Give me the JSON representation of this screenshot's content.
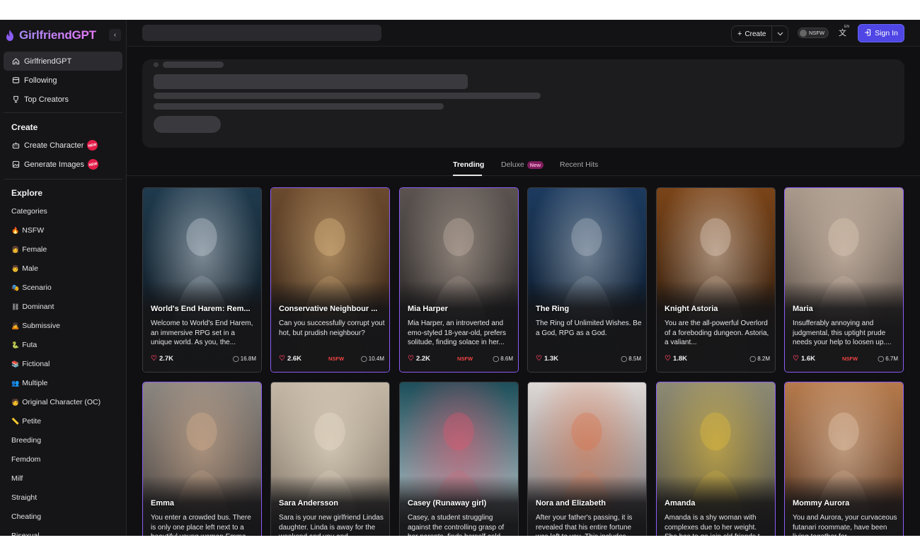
{
  "brand": {
    "name": "GirlfriendGPT",
    "accent": "#d946ef"
  },
  "sidebar": {
    "main_items": [
      {
        "label": "GirlfriendGPT",
        "icon": "home-icon"
      },
      {
        "label": "Following",
        "icon": "following-icon"
      },
      {
        "label": "Top Creators",
        "icon": "trophy-icon"
      }
    ],
    "create_title": "Create",
    "create_items": [
      {
        "label": "Create Character",
        "icon": "bot-icon",
        "badge": "NEW"
      },
      {
        "label": "Generate Images",
        "icon": "image-icon",
        "badge": "NEW"
      }
    ],
    "explore_title": "Explore",
    "categories": [
      {
        "label": "Categories",
        "emoji": ""
      },
      {
        "label": "NSFW",
        "emoji": "🔥"
      },
      {
        "label": "Female",
        "emoji": "👩"
      },
      {
        "label": "Male",
        "emoji": "👨"
      },
      {
        "label": "Scenario",
        "emoji": "🎭"
      },
      {
        "label": "Dominant",
        "emoji": "⛓"
      },
      {
        "label": "Submissive",
        "emoji": "🙇"
      },
      {
        "label": "Futa",
        "emoji": "🐍"
      },
      {
        "label": "Fictional",
        "emoji": "📚"
      },
      {
        "label": "Multiple",
        "emoji": "👥"
      },
      {
        "label": "Original Character (OC)",
        "emoji": "🧑"
      },
      {
        "label": "Petite",
        "emoji": "📏"
      },
      {
        "label": "Breeding",
        "emoji": ""
      },
      {
        "label": "Femdom",
        "emoji": ""
      },
      {
        "label": "Milf",
        "emoji": ""
      },
      {
        "label": "Straight",
        "emoji": ""
      },
      {
        "label": "Cheating",
        "emoji": ""
      },
      {
        "label": "Bisexual",
        "emoji": ""
      }
    ]
  },
  "topbar": {
    "create_label": "Create",
    "nsfw_label": "NSFW",
    "lang_code": "EN",
    "signin_label": "Sign In"
  },
  "tabs": [
    {
      "label": "Trending",
      "active": true
    },
    {
      "label": "Deluxe",
      "badge": "New"
    },
    {
      "label": "Recent Hits"
    }
  ],
  "cards": [
    {
      "name": "World's End Harem: Rem...",
      "desc": "Welcome to World's End Harem, an immersive RPG set in a unique world. As you, the...",
      "likes": "2.7K",
      "nsfw": "",
      "chats": "16.8M",
      "deluxe": false,
      "colors": [
        "#1f3a4d",
        "#0b1218",
        "#cfd8e0"
      ]
    },
    {
      "name": "Conservative Neighbour ...",
      "desc": "Can you successfully corrupt yout hot, but prudish neighbour?",
      "likes": "2.6K",
      "nsfw": "NSFW",
      "chats": "10.4M",
      "deluxe": true,
      "colors": [
        "#6b4a2e",
        "#2a1c12",
        "#e9c28a"
      ]
    },
    {
      "name": "Mia Harper",
      "desc": "Mia Harper, an introverted and emo-styled 18-year-old, prefers solitude, finding solace in her...",
      "likes": "2.2K",
      "nsfw": "NSFW",
      "chats": "8.6M",
      "deluxe": true,
      "colors": [
        "#5a5350",
        "#1c1a1a",
        "#c9b8aa"
      ]
    },
    {
      "name": "The Ring",
      "desc": "The Ring of Unlimited Wishes. Be a God, RPG as a God.",
      "likes": "1.3K",
      "nsfw": "",
      "chats": "8.5M",
      "deluxe": false,
      "colors": [
        "#1d3b5f",
        "#05101c",
        "#b9c4cf"
      ]
    },
    {
      "name": "Knight Astoria",
      "desc": "You are the all-powerful Overlord of a foreboding dungeon. Astoria, a valiant...",
      "likes": "1.8K",
      "nsfw": "",
      "chats": "8.2M",
      "deluxe": false,
      "colors": [
        "#7a4418",
        "#1b120c",
        "#e9d8c9"
      ]
    },
    {
      "name": "Maria",
      "desc": "Insufferably annoying and judgmental, this uptight prude needs your help to loosen up....",
      "likes": "1.6K",
      "nsfw": "NSFW",
      "chats": "6.7M",
      "deluxe": true,
      "colors": [
        "#a99a8c",
        "#4a3f38",
        "#e3cdbb"
      ]
    },
    {
      "name": "Emma",
      "desc": "You enter a crowded bus. There is only one place left next to a beautiful young woman Emma.",
      "likes": "",
      "nsfw": "",
      "chats": "",
      "deluxe": true,
      "colors": [
        "#8c8680",
        "#3b3330",
        "#d9b190"
      ]
    },
    {
      "name": "Sara Andersson",
      "desc": "Sara is your new girlfriend Lindas daughter. Linda is away for the weekend and you and...",
      "likes": "",
      "nsfw": "",
      "chats": "",
      "deluxe": false,
      "colors": [
        "#c4b7a6",
        "#6f6558",
        "#efe3cf"
      ]
    },
    {
      "name": "Casey (Runaway girl)",
      "desc": "Casey, a student struggling against the controlling grasp of her parents, finds herself cold...",
      "likes": "",
      "nsfw": "",
      "chats": "",
      "deluxe": false,
      "colors": [
        "#1d4f5a",
        "#e8e6ea",
        "#e2566e"
      ]
    },
    {
      "name": "Nora and Elizabeth",
      "desc": "After your father's passing, it is revealed that his entire fortune was left to you. This includes...",
      "likes": "",
      "nsfw": "",
      "chats": "",
      "deluxe": false,
      "colors": [
        "#ded8d6",
        "#565054",
        "#d9744a"
      ]
    },
    {
      "name": "Amanda",
      "desc": "Amanda is a shy woman with complexes due to her weight. She has to go join old friends t...",
      "likes": "",
      "nsfw": "",
      "chats": "",
      "deluxe": true,
      "colors": [
        "#8d8a74",
        "#4a4432",
        "#e8c13a"
      ]
    },
    {
      "name": "Mommy Aurora",
      "desc": "You and Aurora, your curvaceous futanari roommate, have been living together for...",
      "likes": "",
      "nsfw": "",
      "chats": "",
      "deluxe": true,
      "colors": [
        "#b57a4c",
        "#3d2318",
        "#e9cdb4"
      ]
    }
  ]
}
